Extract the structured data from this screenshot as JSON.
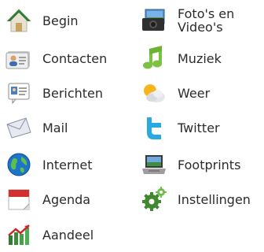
{
  "menu": {
    "left": [
      {
        "id": "home",
        "label": "Begin",
        "icon": "home-icon"
      },
      {
        "id": "contacts",
        "label": "Contacten",
        "icon": "contacts-card-icon"
      },
      {
        "id": "messages",
        "label": "Berichten",
        "icon": "messages-icon"
      },
      {
        "id": "mail",
        "label": "Mail",
        "icon": "mail-envelope-icon"
      },
      {
        "id": "internet",
        "label": "Internet",
        "icon": "globe-icon"
      },
      {
        "id": "calendar",
        "label": "Agenda",
        "icon": "calendar-icon"
      },
      {
        "id": "stocks",
        "label": "Aandeel",
        "icon": "stocks-chart-icon"
      }
    ],
    "right": [
      {
        "id": "photos",
        "label": "Foto's en Video's",
        "icon": "camera-photos-icon"
      },
      {
        "id": "music",
        "label": "Muziek",
        "icon": "music-note-icon"
      },
      {
        "id": "weather",
        "label": "Weer",
        "icon": "weather-cloud-sun-icon"
      },
      {
        "id": "twitter",
        "label": "Twitter",
        "icon": "twitter-icon"
      },
      {
        "id": "footprints",
        "label": "Footprints",
        "icon": "footprints-laptop-icon"
      },
      {
        "id": "settings",
        "label": "Instellingen",
        "icon": "settings-gears-icon"
      }
    ]
  },
  "colors": {
    "text": "#2b2b2b",
    "home_roof": "#2e7d32",
    "music_green": "#7cc242",
    "twitter_blue": "#29a9e1",
    "calendar_red": "#d32f2f",
    "stocks_green": "#4caf50",
    "globe_blue": "#1565c0"
  }
}
